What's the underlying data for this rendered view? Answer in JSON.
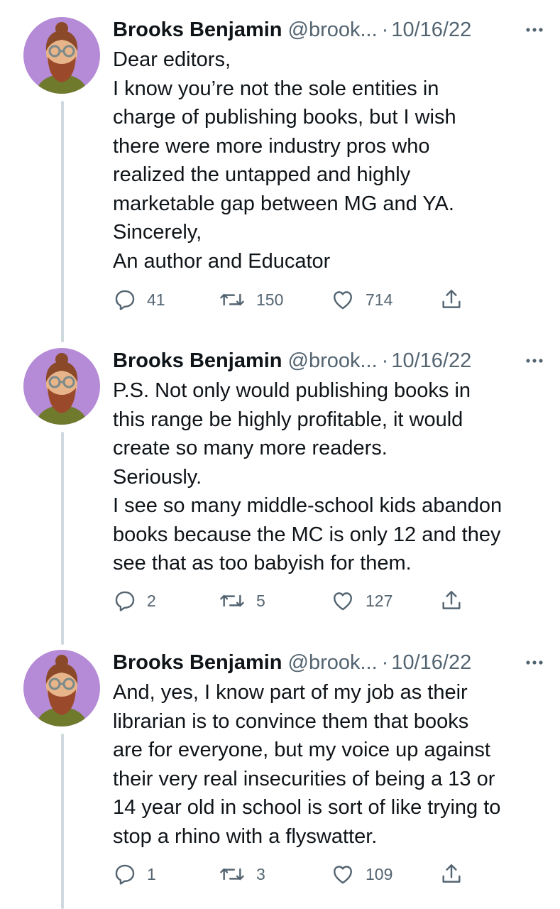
{
  "tweets": [
    {
      "name": "Brooks Benjamin",
      "handle": "@brook...",
      "separator": "·",
      "date": "10/16/22",
      "lines": [
        "Dear editors,",
        "I know you’re not the sole entities in",
        "charge of publishing books, but I wish",
        "there were more industry pros who",
        "realized the untapped and highly",
        "marketable gap between MG and YA.",
        "Sincerely,",
        "An author and Educator"
      ],
      "replies": "41",
      "retweets": "150",
      "likes": "714"
    },
    {
      "name": "Brooks Benjamin",
      "handle": "@brook...",
      "separator": "·",
      "date": "10/16/22",
      "lines": [
        "P.S. Not only would publishing books in",
        "this range be highly profitable, it would",
        "create so many more readers.",
        "Seriously.",
        "I see so many middle-school kids abandon",
        "books because the MC is only 12 and they",
        "see that as too babyish for them."
      ],
      "replies": "2",
      "retweets": "5",
      "likes": "127"
    },
    {
      "name": "Brooks Benjamin",
      "handle": "@brook...",
      "separator": "·",
      "date": "10/16/22",
      "lines": [
        "And, yes, I know part of my job as their",
        "librarian is to convince them that books",
        "are for everyone, but my voice up against",
        "their very real insecurities of being a 13 or",
        "14 year old in school is sort of like trying to",
        "stop a rhino with a flyswatter."
      ],
      "replies": "1",
      "retweets": "3",
      "likes": "109"
    }
  ],
  "icons": {
    "reply": "reply-icon",
    "retweet": "retweet-icon",
    "like": "heart-icon",
    "share": "share-icon",
    "more": "more-options-icon"
  },
  "colors": {
    "text": "#0f1419",
    "secondary": "#536471",
    "thread_line": "#cfd9de",
    "avatar_bg": "#b58ad6"
  }
}
